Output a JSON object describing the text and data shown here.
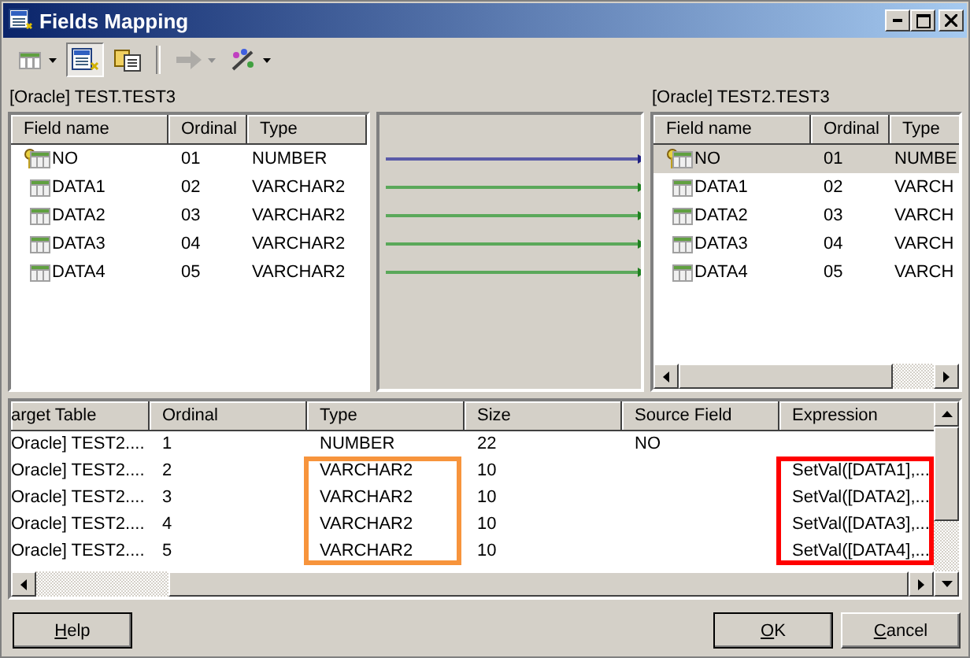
{
  "window": {
    "title": "Fields Mapping"
  },
  "toolbar": [
    {
      "kind": "grid",
      "dropdown": true,
      "pressed": false,
      "disabled": false
    },
    {
      "kind": "edit",
      "dropdown": false,
      "pressed": true,
      "disabled": false
    },
    {
      "kind": "copy",
      "dropdown": false,
      "pressed": false,
      "disabled": false
    },
    {
      "kind": "arrow",
      "dropdown": true,
      "pressed": false,
      "disabled": true
    },
    {
      "kind": "wand",
      "dropdown": true,
      "pressed": false,
      "disabled": false
    }
  ],
  "source": {
    "label": "[Oracle] TEST.TEST3",
    "columns": [
      "Field name",
      "Ordinal",
      "Type"
    ],
    "rows": [
      {
        "key": true,
        "selected": false,
        "cells": [
          "NO",
          "01",
          "NUMBER"
        ]
      },
      {
        "key": false,
        "selected": false,
        "cells": [
          "DATA1",
          "02",
          "VARCHAR2"
        ]
      },
      {
        "key": false,
        "selected": false,
        "cells": [
          "DATA2",
          "03",
          "VARCHAR2"
        ]
      },
      {
        "key": false,
        "selected": false,
        "cells": [
          "DATA3",
          "04",
          "VARCHAR2"
        ]
      },
      {
        "key": false,
        "selected": false,
        "cells": [
          "DATA4",
          "05",
          "VARCHAR2"
        ]
      }
    ]
  },
  "mappings": [
    {
      "color": "#5a5aa8"
    },
    {
      "color": "#5aa85a"
    },
    {
      "color": "#5aa85a"
    },
    {
      "color": "#5aa85a"
    },
    {
      "color": "#5aa85a"
    }
  ],
  "target": {
    "label": "[Oracle] TEST2.TEST3",
    "columns": [
      "Field name",
      "Ordinal",
      "Type"
    ],
    "rows": [
      {
        "key": true,
        "selected": true,
        "cells": [
          "NO",
          "01",
          "NUMBE"
        ]
      },
      {
        "key": false,
        "selected": false,
        "cells": [
          "DATA1",
          "02",
          "VARCH"
        ]
      },
      {
        "key": false,
        "selected": false,
        "cells": [
          "DATA2",
          "03",
          "VARCH"
        ]
      },
      {
        "key": false,
        "selected": false,
        "cells": [
          "DATA3",
          "04",
          "VARCH"
        ]
      },
      {
        "key": false,
        "selected": false,
        "cells": [
          "DATA4",
          "05",
          "VARCH"
        ]
      }
    ]
  },
  "grid": {
    "columns": [
      {
        "label": "arget Table"
      },
      {
        "label": "Ordinal"
      },
      {
        "label": "Type",
        "color": "#f7943c"
      },
      {
        "label": "Size"
      },
      {
        "label": "Source Field"
      },
      {
        "label": "Expression",
        "color": "#ff0000"
      }
    ],
    "rows": [
      [
        "Oracle] TEST2....",
        "1",
        "NUMBER",
        "22",
        "NO",
        ""
      ],
      [
        "Oracle] TEST2....",
        "2",
        "VARCHAR2",
        "10",
        "",
        "SetVal([DATA1],..."
      ],
      [
        "Oracle] TEST2....",
        "3",
        "VARCHAR2",
        "10",
        "",
        "SetVal([DATA2],..."
      ],
      [
        "Oracle] TEST2....",
        "4",
        "VARCHAR2",
        "10",
        "",
        "SetVal([DATA3],..."
      ],
      [
        "Oracle] TEST2....",
        "5",
        "VARCHAR2",
        "10",
        "",
        "SetVal([DATA4],..."
      ]
    ]
  },
  "buttons": [
    {
      "label": "Help"
    },
    {
      "label": "OK"
    },
    {
      "label": "Cancel"
    }
  ]
}
